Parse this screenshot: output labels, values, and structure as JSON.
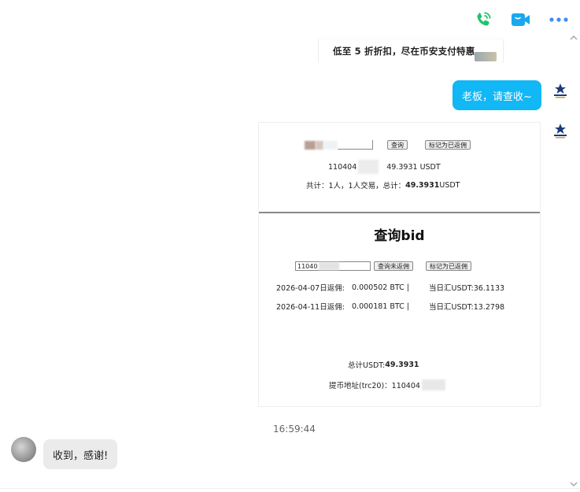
{
  "header": {
    "icons": [
      "phone-call-icon",
      "video-call-icon",
      "more-icon"
    ]
  },
  "banner": {
    "text": "低至 5 折折扣，尽在币安支付特惠"
  },
  "outgoing": {
    "text": "老板，请查收~"
  },
  "doc": {
    "top": {
      "query_button": "查询",
      "mark_button": "标记为已返佣",
      "line1_id": "110404",
      "line1_amount": "49.3931 USDT",
      "summary_prefix": "共计：1人，1人交易，总计：",
      "summary_amount": "49.3931",
      "summary_unit": " USDT"
    },
    "bottom": {
      "title": "查询bid",
      "input_value": "11040",
      "query_unreturned_button": "查询未返佣",
      "mark_button": "标记为已返佣",
      "rows": [
        {
          "date_label": "2026-04-07日返佣:",
          "btc": "0.000502 BTC |",
          "usdt": "当日汇USDT:36.1133"
        },
        {
          "date_label": "2026-04-11日返佣:",
          "btc": "0.000181 BTC |",
          "usdt": "当日汇USDT:13.2798"
        }
      ],
      "total_label": "总计USDT:",
      "total_value": "49.3931",
      "address_label": "提币地址(trc20)：110404"
    }
  },
  "timestamp": "16:59:44",
  "incoming": {
    "text": "收到，感谢!"
  },
  "colors": {
    "bubble_out": "#12b7f5",
    "bubble_in": "#ebebeb",
    "phone_icon": "#21c46c",
    "video_icon": "#1aa7ee",
    "more_icon": "#3d8ef0"
  }
}
